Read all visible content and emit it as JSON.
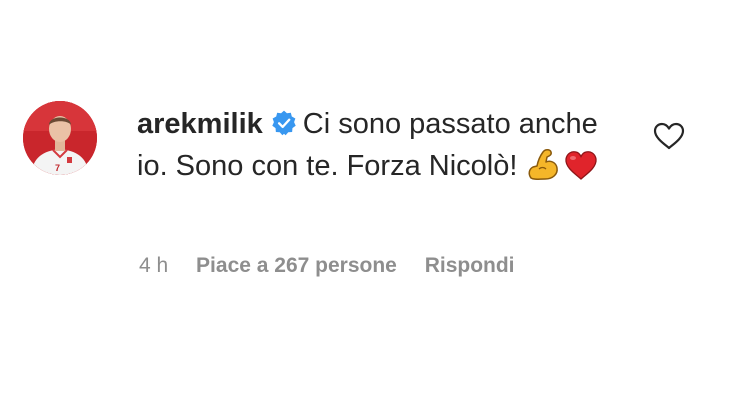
{
  "comment": {
    "username": "arekmilik",
    "text": "Ci sono passato anche io. Sono con te. Forza Nicolò!",
    "emojis": [
      "flexed-biceps",
      "red-heart"
    ],
    "verified": true
  },
  "meta": {
    "time": "4 h",
    "likes": "Piace a 267 persone",
    "reply": "Rispondi"
  },
  "colors": {
    "text": "#262626",
    "meta": "#8e8e8e",
    "verified": "#3897f0",
    "heart": "#e0242b",
    "flex": "#f5b629"
  }
}
